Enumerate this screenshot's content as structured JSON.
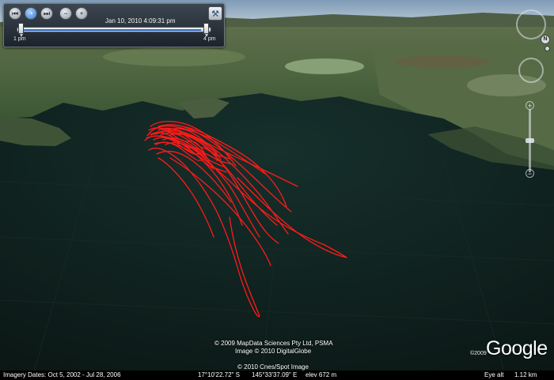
{
  "timebar": {
    "buttons": [
      {
        "name": "prev-button",
        "icon": "rewind-icon",
        "glyph": "⏮"
      },
      {
        "name": "clock-button",
        "icon": "clock-icon",
        "glyph": "◔"
      },
      {
        "name": "next-button",
        "icon": "forward-icon",
        "glyph": "⏭"
      },
      {
        "name": "zoom-out-time-button",
        "icon": "zoom-out-icon",
        "glyph": "−"
      },
      {
        "name": "zoom-in-time-button",
        "icon": "zoom-in-icon",
        "glyph": "+"
      }
    ],
    "wrench_icon": "wrench-icon",
    "date": "Jan 10, 2010   4:09:31 pm",
    "start_label": "1 pm",
    "end_label": "4 pm",
    "fill_fraction": 0.96
  },
  "navigation": {
    "north_label": "N",
    "zoom_plus": "+",
    "zoom_minus": "−",
    "icons": [
      "compass-ring-icon",
      "eye-icon",
      "look-joystick-icon",
      "zoom-slider-icon"
    ]
  },
  "attribution": {
    "line1": "© 2009 MapData Sciences Pty Ltd, PSMA",
    "line2": "Image © 2010 DigitalGlobe",
    "line3": "© 2010 Cnes/Spot Image"
  },
  "logo": {
    "year": "©2009",
    "text": "Google"
  },
  "status": {
    "imagery_dates": "Imagery Dates: Oct  5, 2002 - Jul 28, 2006",
    "lat": "17°10'22.72\" S",
    "lon": "145°33'37.09\" E",
    "elev": "elev  672 m",
    "eye_alt_label": "Eye alt",
    "eye_alt_value": "1.12 km"
  },
  "colors": {
    "track": "#ff1a1a",
    "water": "#0f201d",
    "land": "#4b5e3a"
  }
}
